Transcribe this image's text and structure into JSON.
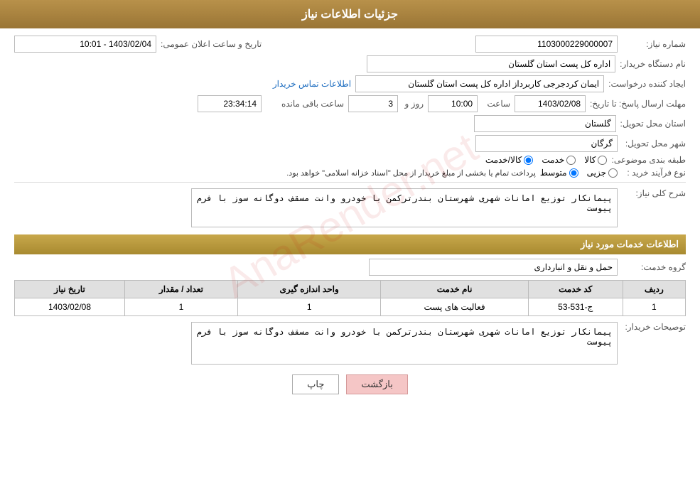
{
  "header": {
    "title": "جزئیات اطلاعات نیاز"
  },
  "fields": {
    "shomareNiaz_label": "شماره نیاز:",
    "shomareNiaz_value": "1103000229000007",
    "namDastgah_label": "نام دستگاه خریدار:",
    "tarikh_label": "تاریخ و ساعت اعلان عمومی:",
    "tarikh_value": "1403/02/04 - 10:01",
    "namDastgah_value": "اداره کل پست استان گلستان",
    "ejadKonande_label": "ایجاد کننده درخواست:",
    "ejadKonande_value": "ایمان کردجرجی کاربرداز اداره کل پست استان گلستان",
    "etelaat_link": "اطلاعات تماس خریدار",
    "mohlatErsal_label": "مهلت ارسال پاسخ: تا تاریخ:",
    "mohlatDate_value": "1403/02/08",
    "mohlatSaat_label": "ساعت",
    "mohlatSaat_value": "10:00",
    "mohlatRooz_label": "روز و",
    "mohlatRooz_value": "3",
    "mohlatSaatMande_label": "ساعت باقی مانده",
    "mohlatSaatMande_value": "23:34:14",
    "ostanTahvil_label": "استان محل تحویل:",
    "ostanTahvil_value": "گلستان",
    "shahrTahvil_label": "شهر محل تحویل:",
    "shahrTahvil_value": "گرگان",
    "tabaqeBandi_label": "طبقه بندی موضوعی:",
    "tabaqe_options": [
      "کالا",
      "خدمت",
      "کالا/خدمت"
    ],
    "tabaqe_selected": "کالا",
    "noFarayand_label": "نوع فرآیند خرید :",
    "noFarayand_options": [
      "جزیی",
      "متوسط"
    ],
    "noFarayand_selected": "متوسط",
    "noFarayand_note": "پرداخت تمام یا بخشی از مبلغ خریدار از محل \"اسناد خزانه اسلامی\" خواهد بود.",
    "sharhKoli_label": "شرح کلی نیاز:",
    "sharhKoli_value": "پیمانکار توزیع امانات شهری شهرستان بندرترکمن با خودرو وانت مسقف دوگانه سوز با فرم پیوست",
    "khadamat_section_title": "اطلاعات خدمات مورد نیاز",
    "groheKhadamat_label": "گروه خدمت:",
    "groheKhadamat_value": "حمل و نقل و انبارداری",
    "table": {
      "headers": [
        "ردیف",
        "کد خدمت",
        "نام خدمت",
        "واحد اندازه گیری",
        "تعداد / مقدار",
        "تاریخ نیاز"
      ],
      "rows": [
        {
          "radif": "1",
          "kodKhadamat": "ج-531-53",
          "namKhadamat": "فعالیت های پست",
          "vahedAndaze": "1",
          "tedad": "1",
          "tarikhNiaz": "1403/02/08"
        }
      ]
    },
    "tosihKharidar_label": "توصیحات خریدار:",
    "tosihKharidar_value": "پیمانکار توزیع امانات شهری شهرستان بندرترکمن با خودرو وانت مسقف دوگانه سوز با فرم پیوست"
  },
  "buttons": {
    "print_label": "چاپ",
    "back_label": "بازگشت"
  }
}
